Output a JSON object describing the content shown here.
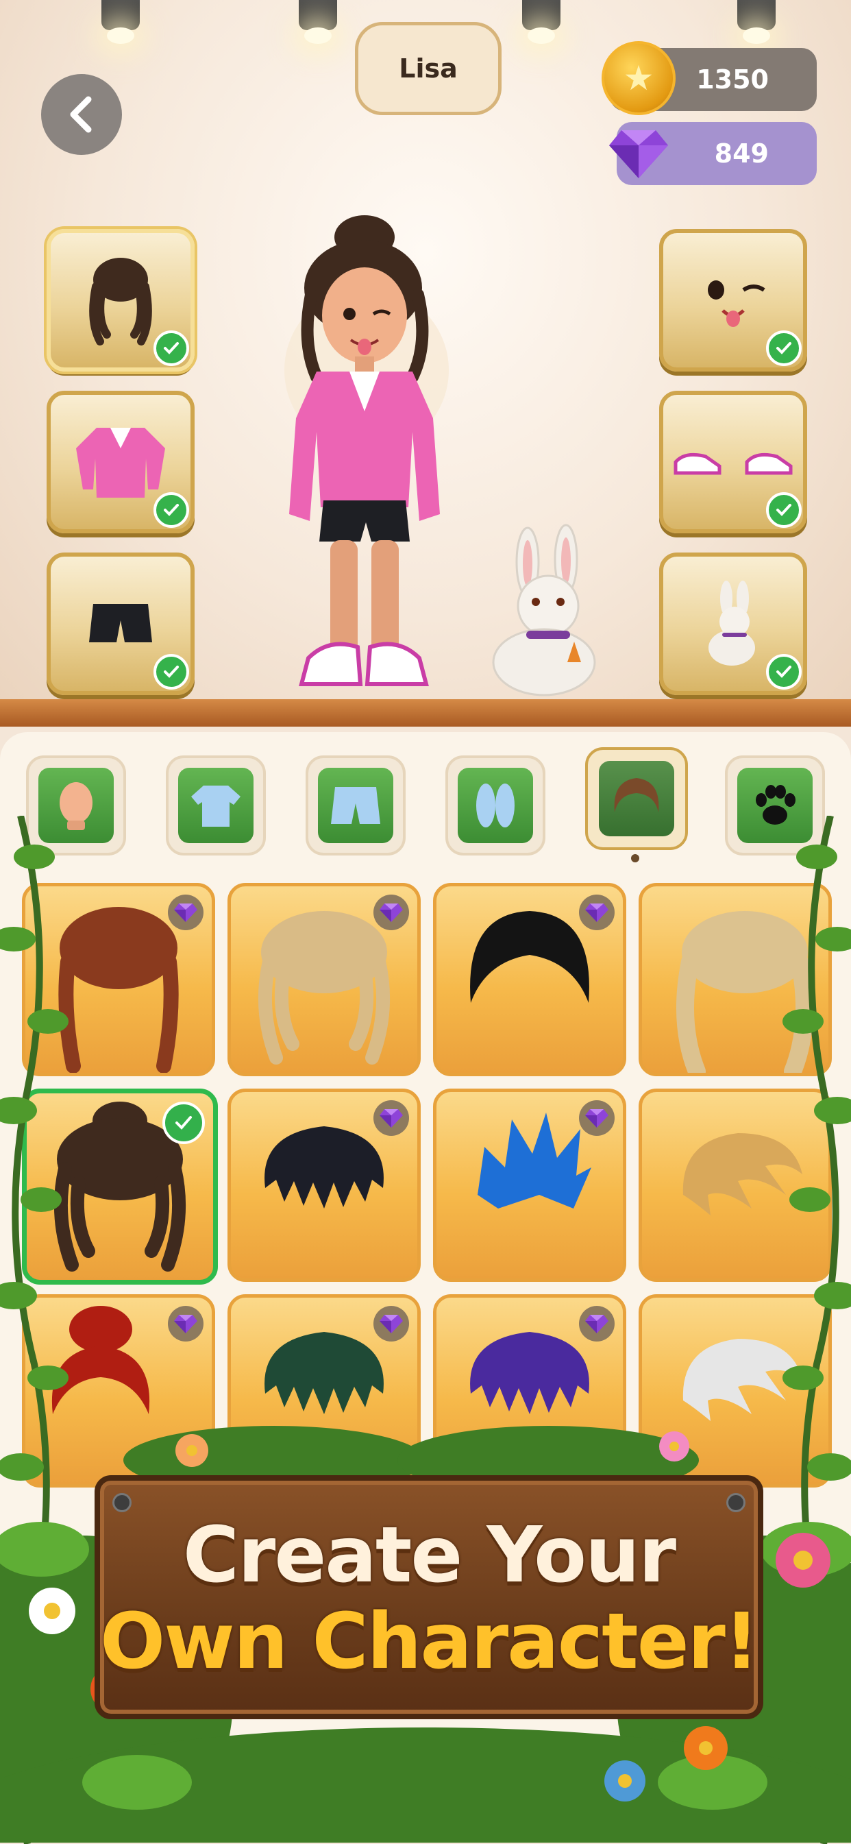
{
  "header": {
    "character_name": "Lisa",
    "coins": "1350",
    "gems": "849"
  },
  "equipped_slots": {
    "left": [
      {
        "name": "hair",
        "checked": true,
        "active": true
      },
      {
        "name": "top",
        "checked": true
      },
      {
        "name": "shorts",
        "checked": true
      }
    ],
    "right": [
      {
        "name": "face",
        "checked": true
      },
      {
        "name": "shoes",
        "checked": true
      },
      {
        "name": "pet",
        "checked": true
      }
    ]
  },
  "category_tabs": [
    {
      "name": "body",
      "icon": "head-icon"
    },
    {
      "name": "tops",
      "icon": "shirt-icon"
    },
    {
      "name": "bottoms",
      "icon": "shorts-icon"
    },
    {
      "name": "shoes",
      "icon": "shoes-icon"
    },
    {
      "name": "hair",
      "icon": "hair-icon",
      "active": true
    },
    {
      "name": "pets",
      "icon": "paw-icon"
    }
  ],
  "hair_items": [
    {
      "style": "braids",
      "color": "#8a3a1e",
      "badge": "gem"
    },
    {
      "style": "curly",
      "color": "#d9bb86",
      "badge": "gem"
    },
    {
      "style": "bob",
      "color": "#141414",
      "badge": "gem"
    },
    {
      "style": "wavy",
      "color": "#dcc28f",
      "badge": "none"
    },
    {
      "style": "curly-bun",
      "color": "#3f2a1e",
      "badge": "check",
      "selected": true
    },
    {
      "style": "messy",
      "color": "#1c1e28",
      "badge": "gem"
    },
    {
      "style": "spiky",
      "color": "#1e6fd6",
      "badge": "gem"
    },
    {
      "style": "swept",
      "color": "#d9a85a",
      "badge": "none"
    },
    {
      "style": "bun",
      "color": "#b01e12",
      "badge": "gem"
    },
    {
      "style": "messy",
      "color": "#1f4a36",
      "badge": "gem"
    },
    {
      "style": "messy",
      "color": "#4a2a9e",
      "badge": "gem"
    },
    {
      "style": "swept",
      "color": "#e6e6e6",
      "badge": "none"
    }
  ],
  "banner": {
    "line1": "Create Your",
    "line2": "Own Character!"
  },
  "colors": {
    "accent_gold": "#f6b94a",
    "check_green": "#35b24b",
    "gem_purple": "#8e44d8"
  }
}
